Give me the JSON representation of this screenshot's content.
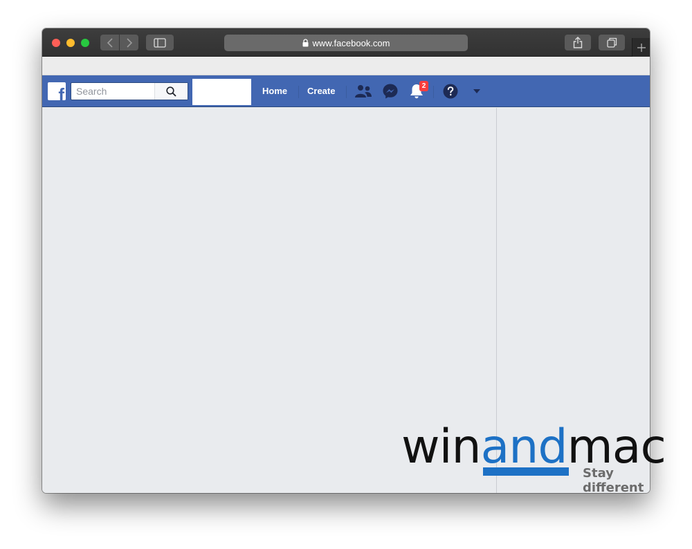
{
  "browser": {
    "url": "www.facebook.com"
  },
  "facebook": {
    "search_placeholder": "Search",
    "nav": {
      "home": "Home",
      "create": "Create"
    },
    "notifications_count": "2",
    "brand_color": "#4267b2",
    "badge_color": "#fa3e3e"
  },
  "watermark": {
    "part1": "win",
    "part2": "and",
    "part3": "mac",
    "tagline": "Stay different",
    "accent_color": "#1d71c5"
  }
}
